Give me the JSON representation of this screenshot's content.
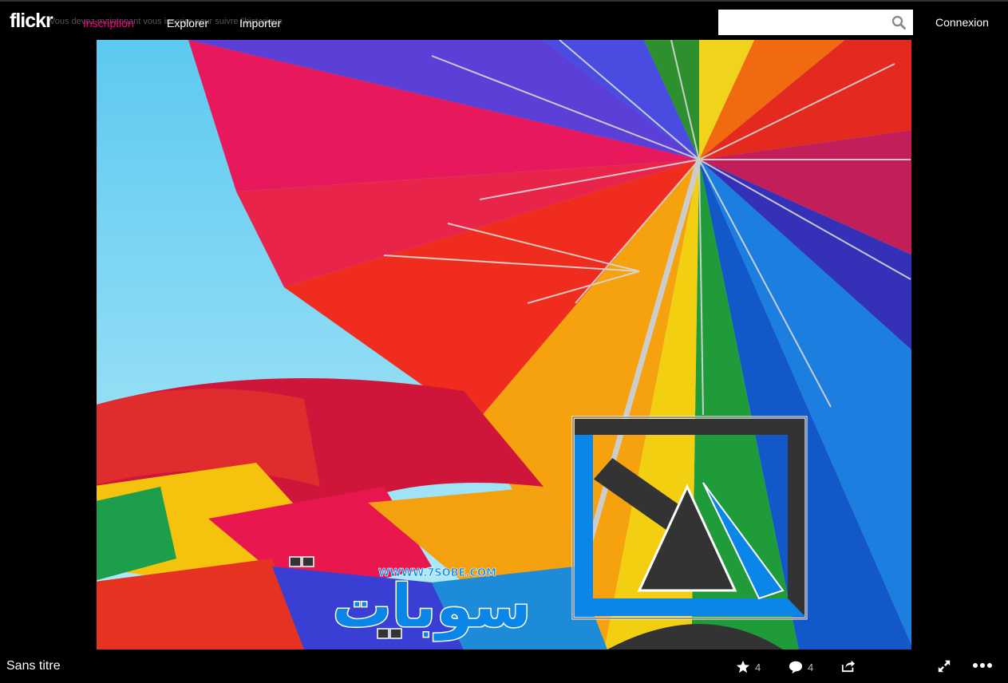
{
  "brand": {
    "logo": "flickr",
    "notice": "Vous devez maintenant vous inscrire pour suivre l'historique"
  },
  "nav": {
    "signup": "Inscription",
    "explore": "Explorer",
    "upload": "Importer"
  },
  "search": {
    "placeholder": "",
    "icon": "search-icon"
  },
  "header": {
    "login": "Connexion"
  },
  "watermark": {
    "url": "WWWW.7SOBE.COM",
    "text": "سوبات"
  },
  "photo": {
    "title": "Sans titre",
    "favorites": "4",
    "comments": "4"
  },
  "colors": {
    "signup": "#ff0084",
    "watermark_blue": "#0a86e8",
    "watermark_dark": "#333333"
  }
}
